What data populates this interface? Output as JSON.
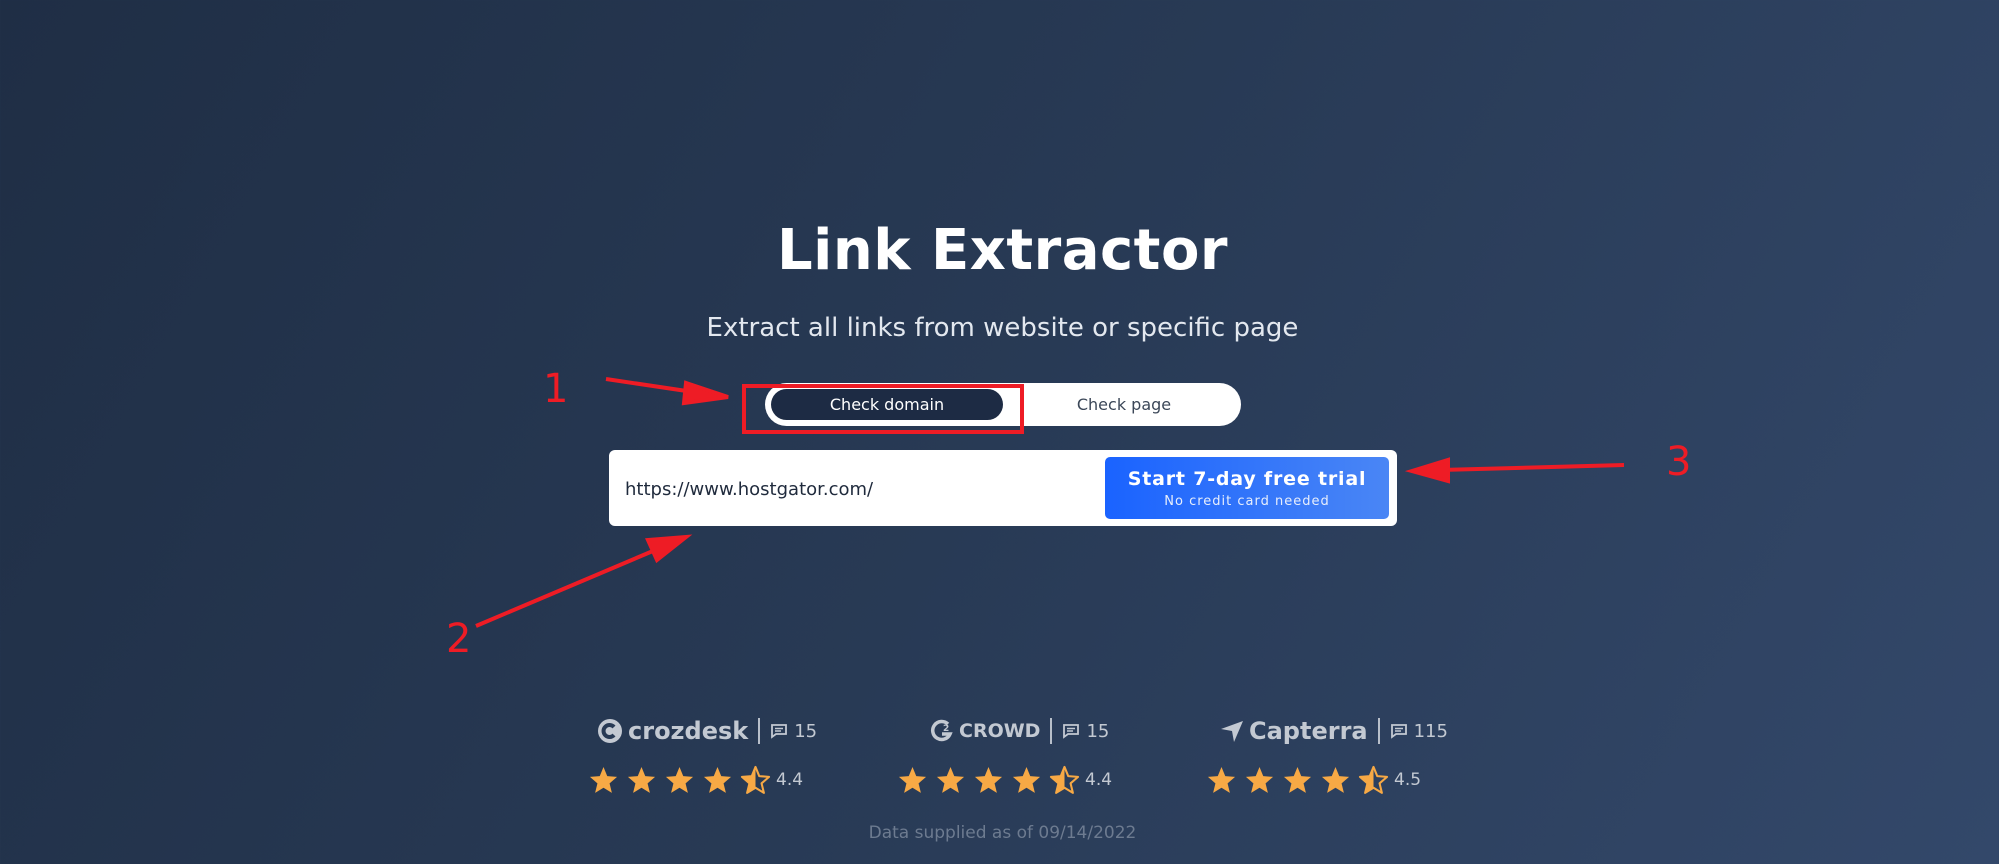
{
  "hero": {
    "title": "Link Extractor",
    "subtitle": "Extract all links from website or specific page"
  },
  "mode_toggle": {
    "options": [
      "Check domain",
      "Check page"
    ],
    "selected": "Check domain"
  },
  "search": {
    "url_value": "https://www.hostgator.com/",
    "cta_label": "Start 7-day free trial",
    "cta_sublabel": "No credit card needed"
  },
  "annotations": [
    "1",
    "2",
    "3"
  ],
  "reviews": [
    {
      "brand": "crozdesk",
      "icon": "crozdesk-logo-icon",
      "count": "15",
      "rating": "4.4",
      "stars": 4.4
    },
    {
      "brand": "CROWD",
      "icon": "g2-logo-icon",
      "count": "15",
      "rating": "4.4",
      "stars": 4.4
    },
    {
      "brand": "Capterra",
      "icon": "capterra-logo-icon",
      "count": "115",
      "rating": "4.5",
      "stars": 4.5
    }
  ],
  "footer": {
    "note": "Data supplied as of 09/14/2022"
  },
  "colors": {
    "background_start": "#1f2e45",
    "background_end": "#33486a",
    "toggle_selected": "#1d2b44",
    "cta_start": "#1a63ff",
    "cta_end": "#4a86f5",
    "annotation_red": "#ee1c25",
    "star": "#f7a945"
  }
}
